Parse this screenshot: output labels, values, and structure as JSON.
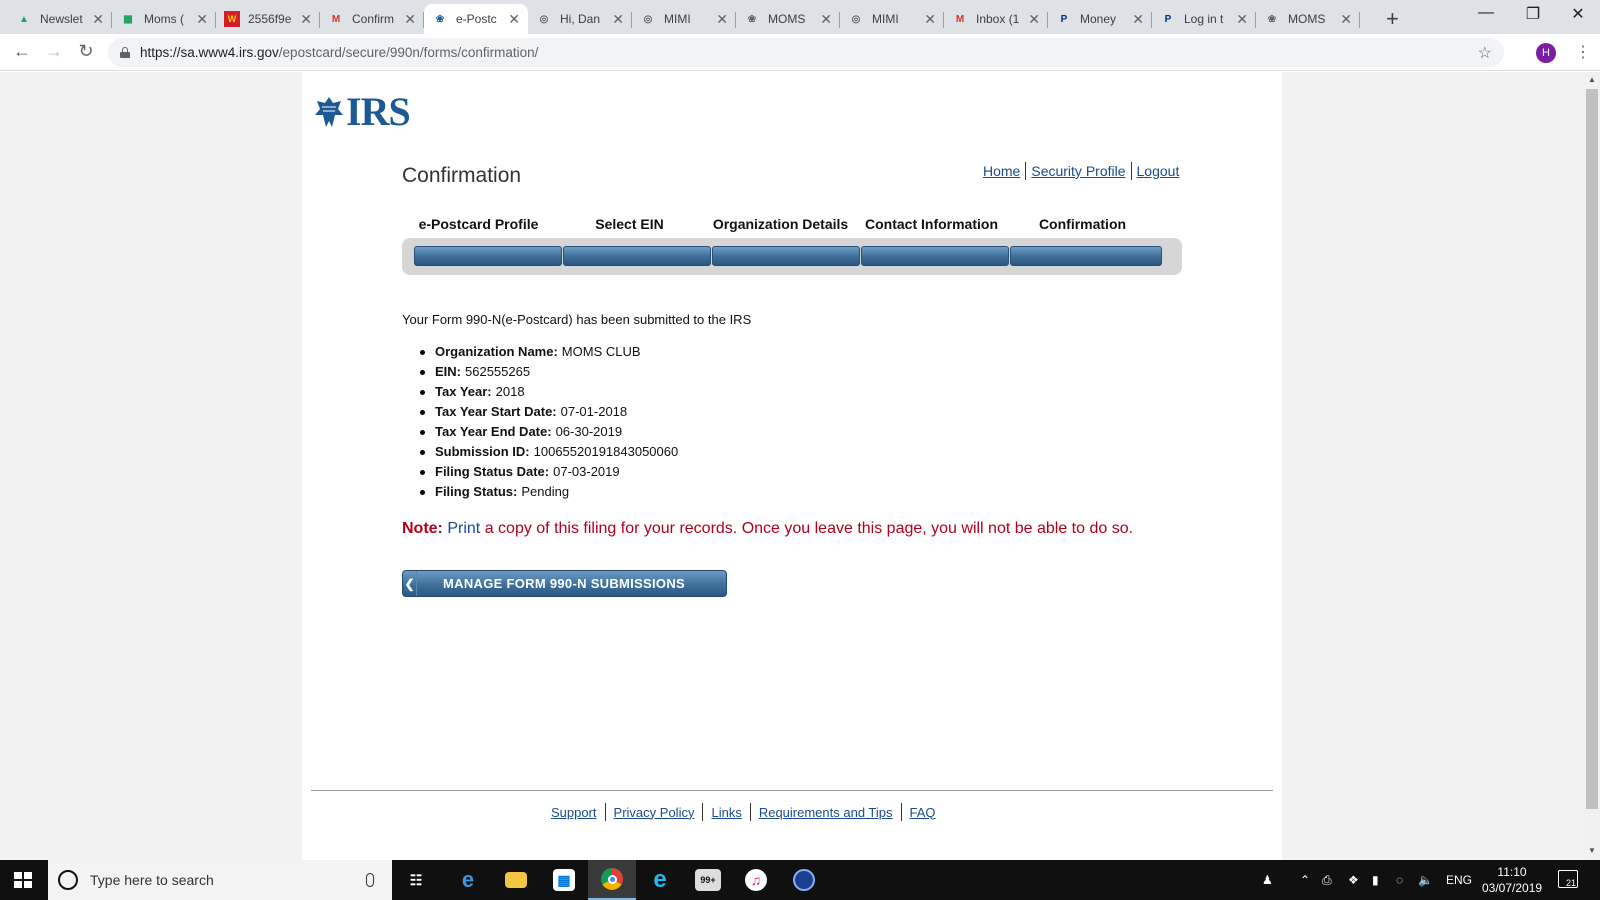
{
  "browser": {
    "tabs": [
      {
        "title": "Newslet",
        "icon": "google-drive-icon",
        "color": "#1fa463"
      },
      {
        "title": "Moms (",
        "icon": "google-sheets-icon",
        "color": "#0f9d58"
      },
      {
        "title": "2556f9e",
        "icon": "wf-icon",
        "color": "#d71e28"
      },
      {
        "title": "Confirm",
        "icon": "gmail-icon",
        "color": "#d93025"
      },
      {
        "title": "e-Postc",
        "icon": "irs-eagle-icon",
        "color": "#1c5a96",
        "active": true
      },
      {
        "title": "Hi, Dan",
        "icon": "globe-icon",
        "color": "#5f6368"
      },
      {
        "title": "MIMI",
        "icon": "globe-icon",
        "color": "#5f6368"
      },
      {
        "title": "MOMS",
        "icon": "irs-eagle-icon",
        "color": "#5f6368"
      },
      {
        "title": "MIMI",
        "icon": "globe-icon",
        "color": "#5f6368"
      },
      {
        "title": "Inbox (1",
        "icon": "gmail-icon",
        "color": "#d93025"
      },
      {
        "title": "Money",
        "icon": "paypal-icon",
        "color": "#003087"
      },
      {
        "title": "Log in t",
        "icon": "paypal-icon",
        "color": "#003087"
      },
      {
        "title": "MOMS",
        "icon": "irs-eagle-icon",
        "color": "#5f6368"
      }
    ],
    "url_host": "https://sa.www4.irs.gov",
    "url_path": "/epostcard/secure/990n/forms/confirmation/",
    "profile_initial": "H"
  },
  "page": {
    "logo_text": "IRS",
    "title": "Confirmation",
    "top_links": [
      "Home",
      "Security Profile",
      "Logout"
    ],
    "steps": [
      "e-Postcard Profile",
      "Select EIN",
      "Organization Details",
      "Contact Information",
      "Confirmation"
    ],
    "message": "Your Form 990-N(e-Postcard) has been submitted to the IRS",
    "details": [
      {
        "label": "Organization Name:",
        "value": "MOMS CLUB"
      },
      {
        "label": "EIN:",
        "value": "562555265"
      },
      {
        "label": "Tax Year:",
        "value": "2018"
      },
      {
        "label": "Tax Year Start Date:",
        "value": "07-01-2018"
      },
      {
        "label": "Tax Year End Date:",
        "value": "06-30-2019"
      },
      {
        "label": "Submission ID:",
        "value": "10065520191843050060"
      },
      {
        "label": "Filing Status Date:",
        "value": "07-03-2019"
      },
      {
        "label": "Filing Status:",
        "value": "Pending"
      }
    ],
    "note_label": "Note:",
    "note_link": "Print",
    "note_text": " a copy of this filing for your records. Once you leave this page, you will not be able to do so.",
    "manage_button": "MANAGE FORM 990-N SUBMISSIONS",
    "footer_links": [
      "Support",
      "Privacy Policy",
      "Links",
      "Requirements and Tips",
      "FAQ"
    ]
  },
  "taskbar": {
    "search_placeholder": "Type here to search",
    "language": "ENG",
    "time": "11:10",
    "date": "03/07/2019",
    "notification_count": "21",
    "mail_badge": "99+"
  }
}
